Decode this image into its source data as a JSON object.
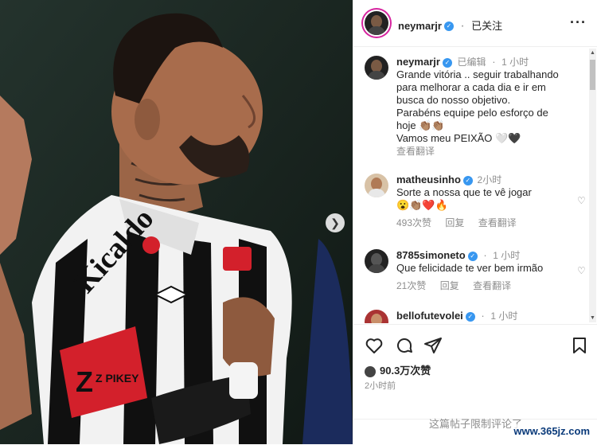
{
  "post": {
    "author": "neymarjr",
    "follow_status": "已关注",
    "more_icon": "···",
    "caption": {
      "edited": "已编辑",
      "time": "1 小时",
      "lines": [
        "Grande vitória .. seguir trabalhando",
        "para melhorar a cada dia e ir em",
        "busca do nosso objetivo.",
        "Parabéns equipe pelo esforço de",
        "hoje 👏🏽👏🏽",
        "Vamos meu PEIXÃO 🤍🖤"
      ],
      "see_translation": "查看翻译"
    }
  },
  "comments": [
    {
      "user": "matheusinho",
      "time": "2小时",
      "text_lines": [
        "Sorte a nossa que te vê jogar",
        "😮👏🏽❤️🔥"
      ],
      "likes": "493次赞",
      "reply": "回复",
      "translate": "查看翻译"
    },
    {
      "user": "8785simoneto",
      "time": "1 小时",
      "text_lines": [
        "Que felicidade te ver bem irmão"
      ],
      "likes": "21次赞",
      "reply": "回复",
      "translate": "查看翻译"
    },
    {
      "user": "bellofutevolei",
      "time": "1 小时",
      "text_lines": [],
      "likes": "",
      "reply": "",
      "translate": ""
    }
  ],
  "actions": {
    "like_count": "90.3万次赞",
    "time": "2小时前"
  },
  "comments_restricted": "这篇帖子限制评论了",
  "watermark": "www.365jz.com",
  "photo": {
    "jersey_text": "Kicaldo",
    "armband": "Z PIKEY"
  },
  "colors": {
    "verified": "#3897f0",
    "muted": "#8e8e8e",
    "text": "#262626"
  }
}
